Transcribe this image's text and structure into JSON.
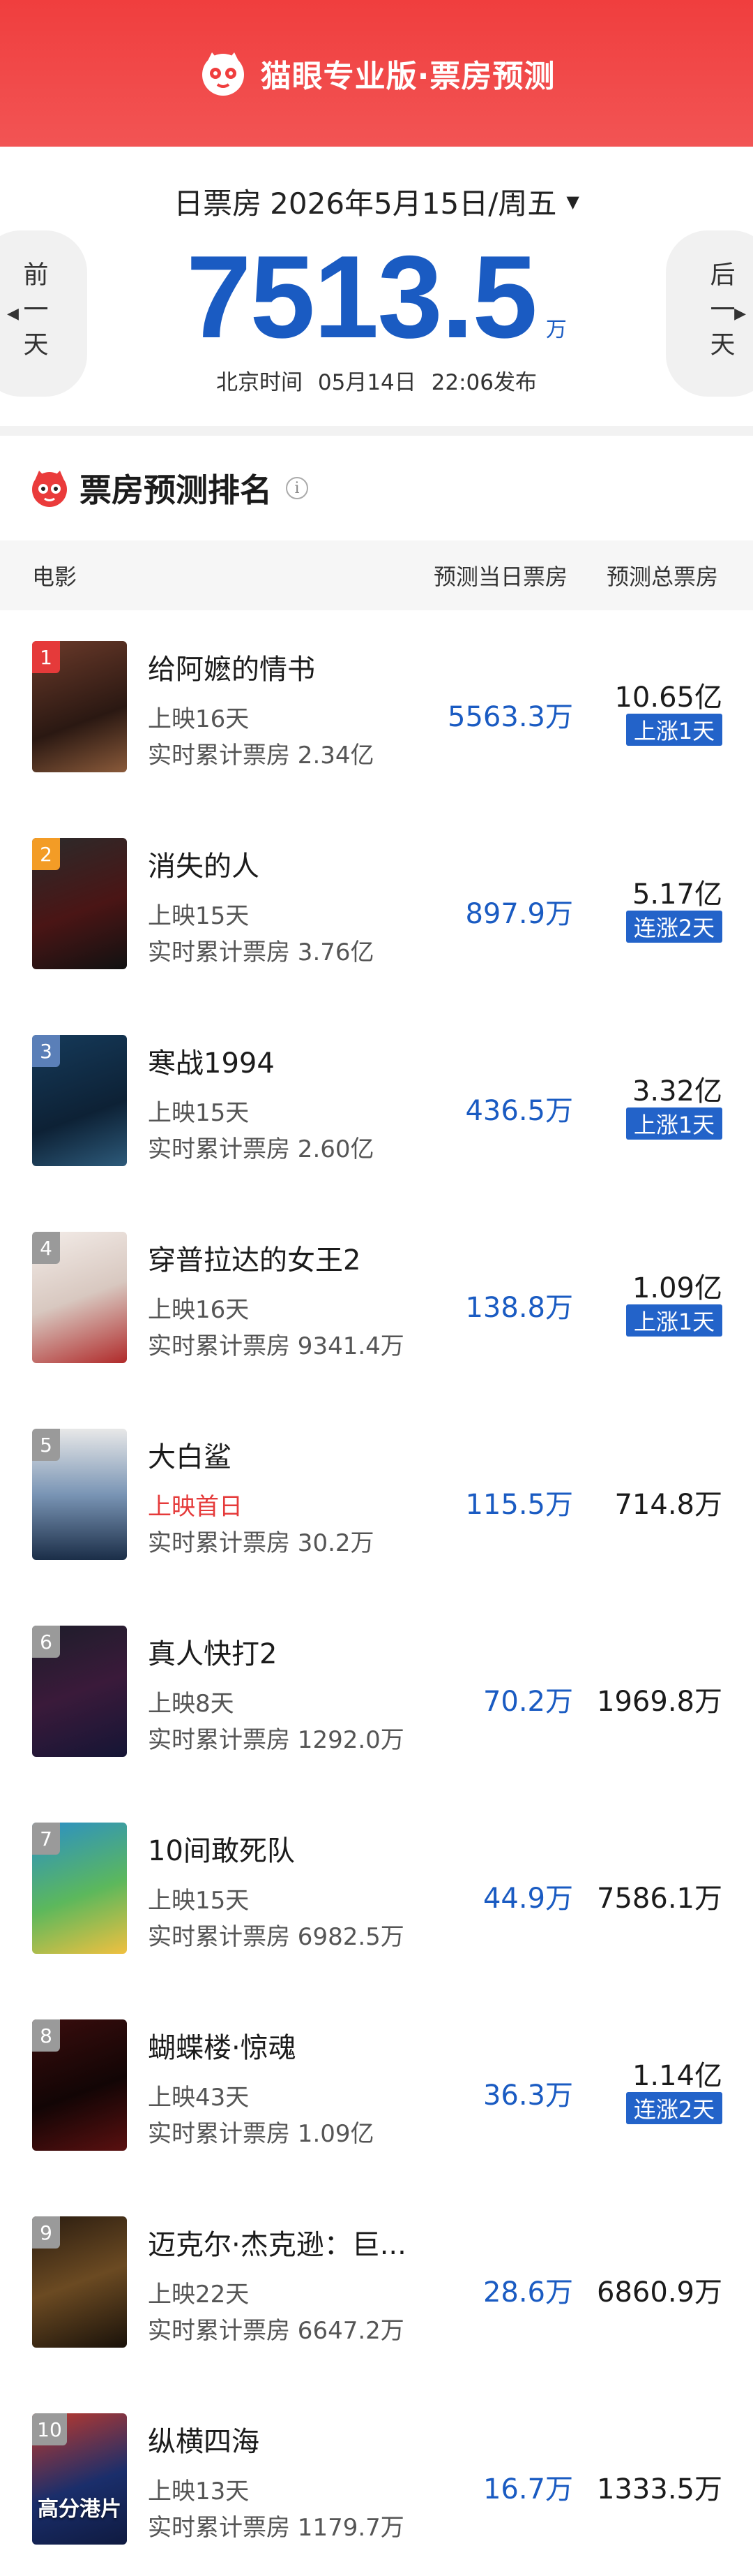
{
  "header": {
    "brand": "猫眼专业版·票房预测"
  },
  "summary": {
    "date_label": "日票房",
    "date": "2026年5月15日/周五",
    "total_value": "7513.5",
    "total_unit": "万",
    "publish_prefix": "北京时间",
    "publish_date": "05月14日",
    "publish_time": "22:06发布",
    "prev_label": "前一天",
    "next_label": "后一天"
  },
  "section": {
    "title": "票房预测排名"
  },
  "table": {
    "col_movie": "电影",
    "col_day": "预测当日票房",
    "col_total": "预测总票房"
  },
  "colors": {
    "accent_red": "#f03e3e",
    "accent_blue": "#1a5bc2",
    "badge_blue": "#2363c9"
  },
  "movies": [
    {
      "rank": "1",
      "name": "给阿嬷的情书",
      "days": "上映16天",
      "cum": "实时累计票房 2.34亿",
      "day_box": "5563.3万",
      "total": "10.65亿",
      "badge": "上涨1天",
      "poster_text": ""
    },
    {
      "rank": "2",
      "name": "消失的人",
      "days": "上映15天",
      "cum": "实时累计票房 3.76亿",
      "day_box": "897.9万",
      "total": "5.17亿",
      "badge": "连涨2天",
      "poster_text": ""
    },
    {
      "rank": "3",
      "name": "寒战1994",
      "days": "上映15天",
      "cum": "实时累计票房 2.60亿",
      "day_box": "436.5万",
      "total": "3.32亿",
      "badge": "上涨1天",
      "poster_text": ""
    },
    {
      "rank": "4",
      "name": "穿普拉达的女王2",
      "days": "上映16天",
      "cum": "实时累计票房 9341.4万",
      "day_box": "138.8万",
      "total": "1.09亿",
      "badge": "上涨1天",
      "poster_text": ""
    },
    {
      "rank": "5",
      "name": "大白鲨",
      "days": "上映首日",
      "cum": "实时累计票房 30.2万",
      "day_box": "115.5万",
      "total": "714.8万",
      "badge": "",
      "poster_text": ""
    },
    {
      "rank": "6",
      "name": "真人快打2",
      "days": "上映8天",
      "cum": "实时累计票房 1292.0万",
      "day_box": "70.2万",
      "total": "1969.8万",
      "badge": "",
      "poster_text": ""
    },
    {
      "rank": "7",
      "name": "10间敢死队",
      "days": "上映15天",
      "cum": "实时累计票房 6982.5万",
      "day_box": "44.9万",
      "total": "7586.1万",
      "badge": "",
      "poster_text": ""
    },
    {
      "rank": "8",
      "name": "蝴蝶楼·惊魂",
      "days": "上映43天",
      "cum": "实时累计票房 1.09亿",
      "day_box": "36.3万",
      "total": "1.14亿",
      "badge": "连涨2天",
      "poster_text": ""
    },
    {
      "rank": "9",
      "name": "迈克尔·杰克逊：巨...",
      "days": "上映22天",
      "cum": "实时累计票房 6647.2万",
      "day_box": "28.6万",
      "total": "6860.9万",
      "badge": "",
      "poster_text": ""
    },
    {
      "rank": "10",
      "name": "纵横四海",
      "days": "上映13天",
      "cum": "实时累计票房 1179.7万",
      "day_box": "16.7万",
      "total": "1333.5万",
      "badge": "",
      "poster_text": "高分港片"
    }
  ]
}
